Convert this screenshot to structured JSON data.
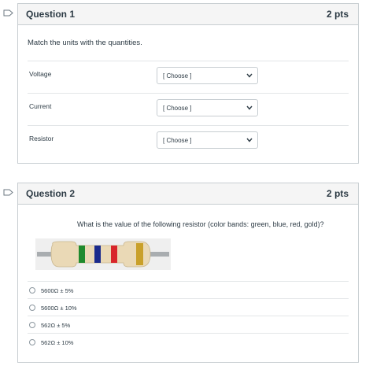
{
  "colors": {
    "header_bg": "#f5f5f5",
    "border": "#c7cdd1",
    "text": "#2d3b45",
    "flag_stroke": "#6b7780"
  },
  "question1": {
    "title": "Question 1",
    "points": "2 pts",
    "prompt": "Match the units with the quantities.",
    "rows": [
      {
        "label": "Voltage",
        "select_value": "[ Choose ]"
      },
      {
        "label": "Current",
        "select_value": "[ Choose ]"
      },
      {
        "label": "Resistor",
        "select_value": "[ Choose ]"
      }
    ]
  },
  "question2": {
    "title": "Question 2",
    "points": "2 pts",
    "prompt": "What is the value of the following resistor (color bands: green, blue, red, gold)?",
    "resistor_bands": [
      "#1f8a2e",
      "#1a2a8c",
      "#d8262b",
      "#c9a02a"
    ],
    "answers": [
      {
        "label": "5600Ω ± 5%"
      },
      {
        "label": "5600Ω ± 10%"
      },
      {
        "label": "562Ω ± 5%"
      },
      {
        "label": "562Ω ± 10%"
      }
    ]
  },
  "icons": {
    "flag": "bookmark-flag-icon",
    "chevron": "chevron-down-icon",
    "radio": "radio-button-icon"
  }
}
